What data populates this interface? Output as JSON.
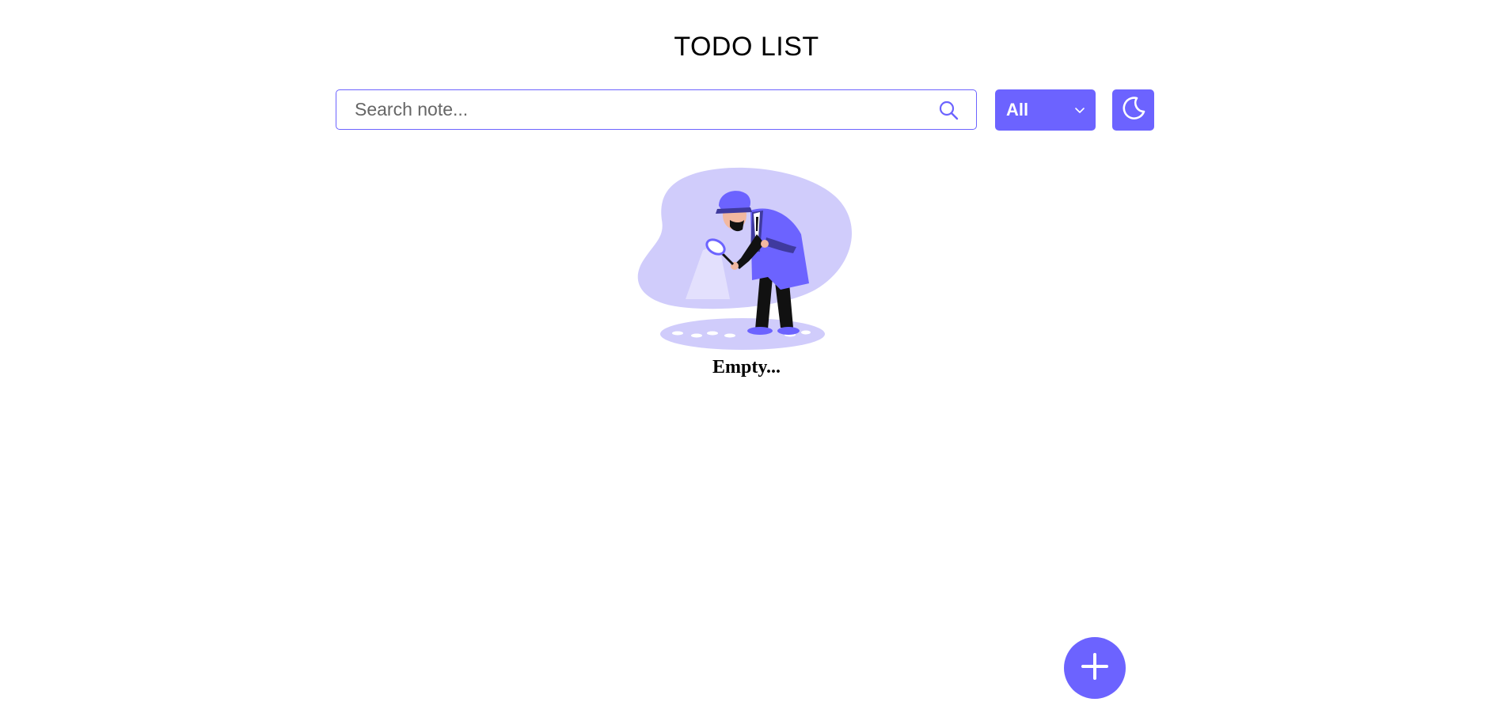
{
  "app": {
    "title": "TODO LIST"
  },
  "search": {
    "placeholder": "Search note...",
    "value": "",
    "icon": "search-icon"
  },
  "filter": {
    "selected": "All",
    "icon": "chevron-down-icon"
  },
  "theme_toggle": {
    "icon": "moon-icon"
  },
  "empty_state": {
    "message": "Empty..."
  },
  "add_button": {
    "icon": "plus-icon"
  },
  "colors": {
    "accent": "#6c63ff",
    "illustration_light": "#d0ccfb",
    "background": "#ffffff"
  }
}
